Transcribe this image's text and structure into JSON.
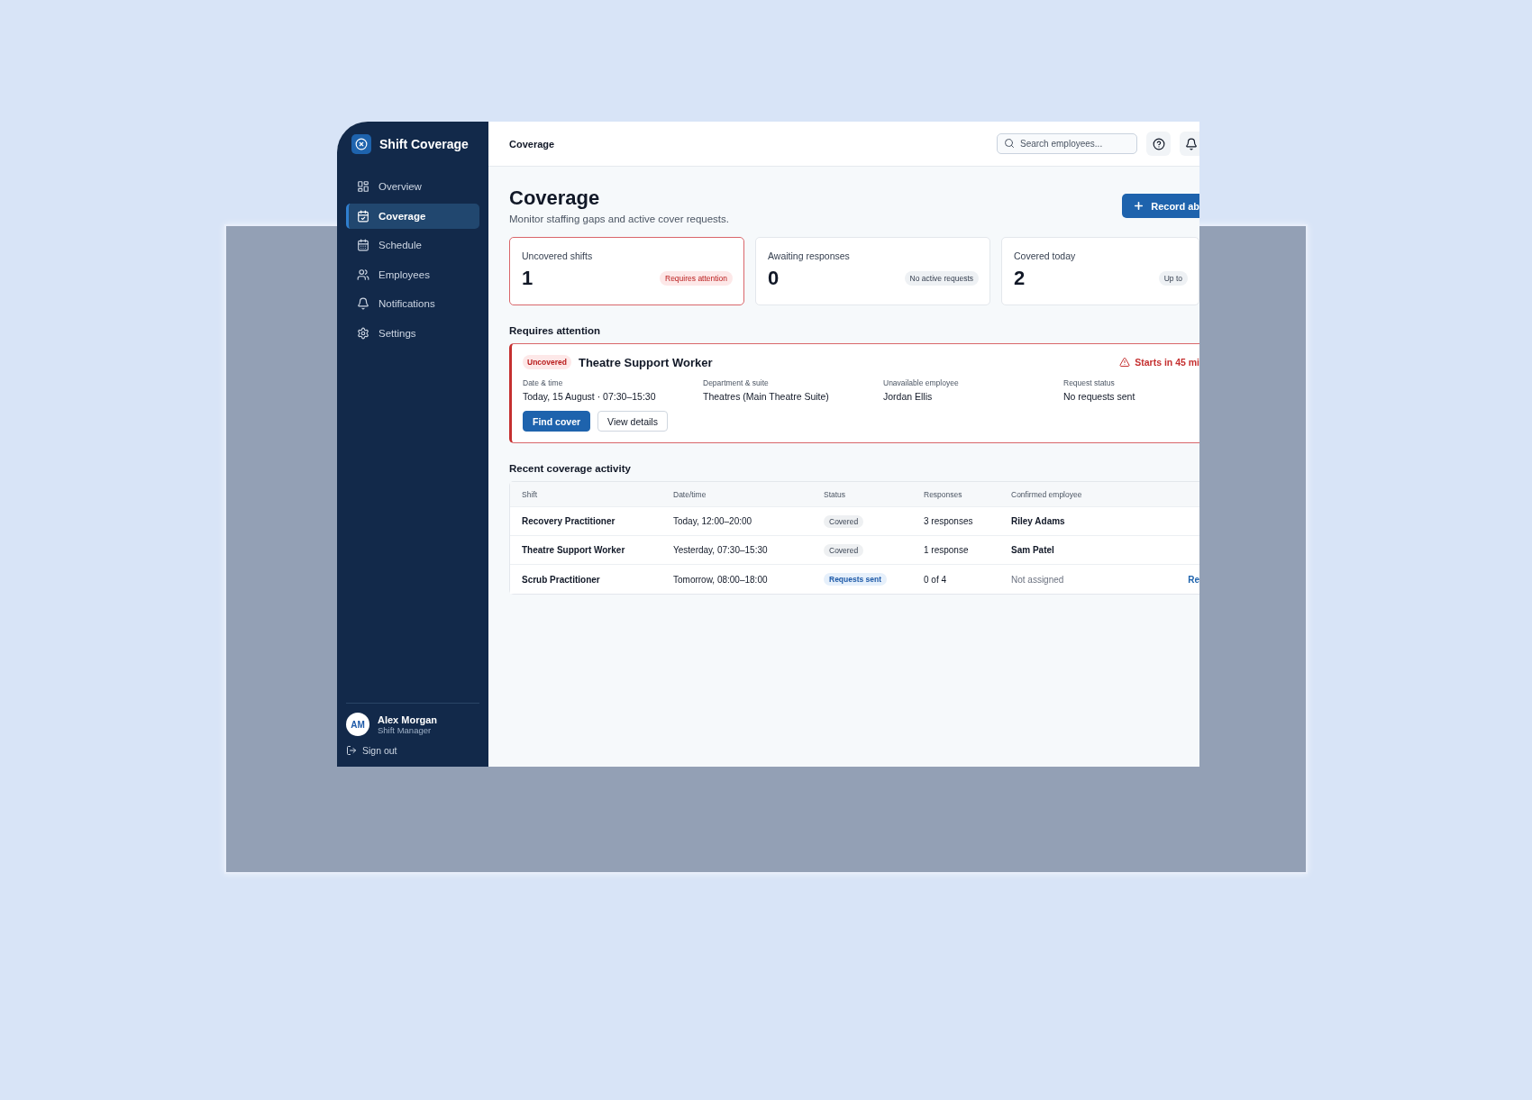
{
  "sidebar": {
    "brand": "Shift Coverage",
    "items": [
      {
        "label": "Overview",
        "selected": false
      },
      {
        "label": "Coverage",
        "selected": true
      },
      {
        "label": "Schedule",
        "selected": false
      },
      {
        "label": "Employees",
        "selected": false
      },
      {
        "label": "Notifications",
        "selected": false
      },
      {
        "label": "Settings",
        "selected": false
      }
    ],
    "user": {
      "initials": "AM",
      "name": "Alex Morgan",
      "role": "Shift Manager"
    },
    "sign_out": "Sign out"
  },
  "topbar": {
    "breadcrumb": "Coverage",
    "search": {
      "placeholder": "Search employees..."
    }
  },
  "page": {
    "title": "Coverage",
    "subtitle": "Monitor staffing gaps and active cover requests.",
    "action": "Record ab"
  },
  "stats": [
    {
      "label": "Uncovered shifts",
      "value": "1",
      "badge": "Requires attention",
      "alert": true
    },
    {
      "label": "Awaiting responses",
      "value": "0",
      "badge": "No active requests",
      "alert": false
    },
    {
      "label": "Covered today",
      "value": "2",
      "badge": "Up to",
      "alert": false
    }
  ],
  "attention": {
    "heading": "Requires attention",
    "status": "Uncovered",
    "title": "Theatre Support Worker",
    "warning": "Starts in 45 mi",
    "details": [
      {
        "label": "Date & time",
        "value": "Today, 15 August · 07:30–15:30"
      },
      {
        "label": "Department & suite",
        "value": "Theatres (Main Theatre Suite)"
      },
      {
        "label": "Unavailable employee",
        "value": "Jordan Ellis"
      },
      {
        "label": "Request status",
        "value": "No requests sent"
      }
    ],
    "buttons": [
      {
        "label": "Find cover",
        "kind": "primary"
      },
      {
        "label": "View details",
        "kind": "secondary"
      }
    ]
  },
  "activity": {
    "heading": "Recent coverage activity",
    "columns": [
      "Shift",
      "Date/time",
      "Status",
      "Responses",
      "Confirmed employee"
    ],
    "rows": [
      {
        "shift": "Recovery Practitioner",
        "datetime": "Today, 12:00–20:00",
        "status": {
          "text": "Covered",
          "kind": "covered"
        },
        "responses": "3 responses",
        "employee": "Riley Adams",
        "assigned": true
      },
      {
        "shift": "Theatre Support Worker",
        "datetime": "Yesterday, 07:30–15:30",
        "status": {
          "text": "Covered",
          "kind": "covered"
        },
        "responses": "1 response",
        "employee": "Sam Patel",
        "assigned": true
      },
      {
        "shift": "Scrub Practitioner",
        "datetime": "Tomorrow, 08:00–18:00",
        "status": {
          "text": "Requests sent",
          "kind": "requested"
        },
        "responses": "0 of 4",
        "employee": "Not assigned",
        "assigned": false,
        "action": "Re"
      }
    ]
  }
}
